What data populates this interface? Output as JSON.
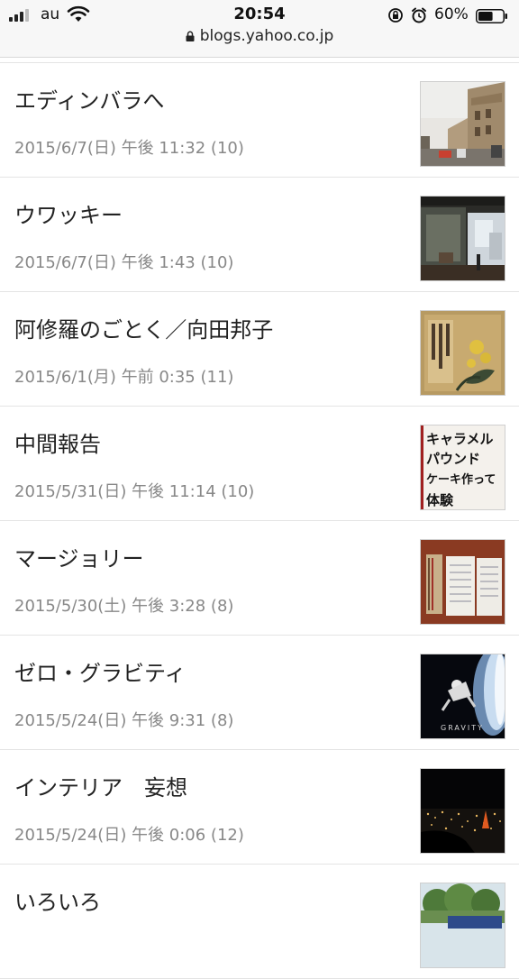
{
  "status_bar": {
    "carrier": "au",
    "time": "20:54",
    "battery": "60%",
    "battery_level": 0.6,
    "url": "blogs.yahoo.co.jp"
  },
  "posts": [
    {
      "title": "エディンバラへ",
      "meta": "2015/6/7(日) 午後 11:32 (10)",
      "thumb": "street-photo"
    },
    {
      "title": "ウワッキー",
      "meta": "2015/6/7(日) 午後 1:43 (10)",
      "thumb": "cafe-window-photo"
    },
    {
      "title": "阿修羅のごとく／向田邦子",
      "meta": "2015/6/1(月) 午前 0:35 (11)",
      "thumb": "book-cover-photo"
    },
    {
      "title": "中間報告",
      "meta": "2015/5/31(日) 午後 11:14 (10)",
      "thumb": "handwritten-note-photo"
    },
    {
      "title": "マージョリー",
      "meta": "2015/5/30(土) 午後 3:28 (8)",
      "thumb": "notebooks-photo"
    },
    {
      "title": "ゼロ・グラビティ",
      "meta": "2015/5/24(日) 午後 9:31 (8)",
      "thumb": "movie-poster-photo"
    },
    {
      "title": "インテリア　妄想",
      "meta": "2015/5/24(日) 午後 0:06 (12)",
      "thumb": "night-city-photo"
    },
    {
      "title": "いろいろ",
      "meta": "",
      "thumb": "trees-photo"
    }
  ],
  "thumb_texts": {
    "note_lines": [
      "キャラメル",
      "パウンド",
      "ケーキ作って",
      "体験"
    ],
    "poster_word": "GRAVITY"
  }
}
